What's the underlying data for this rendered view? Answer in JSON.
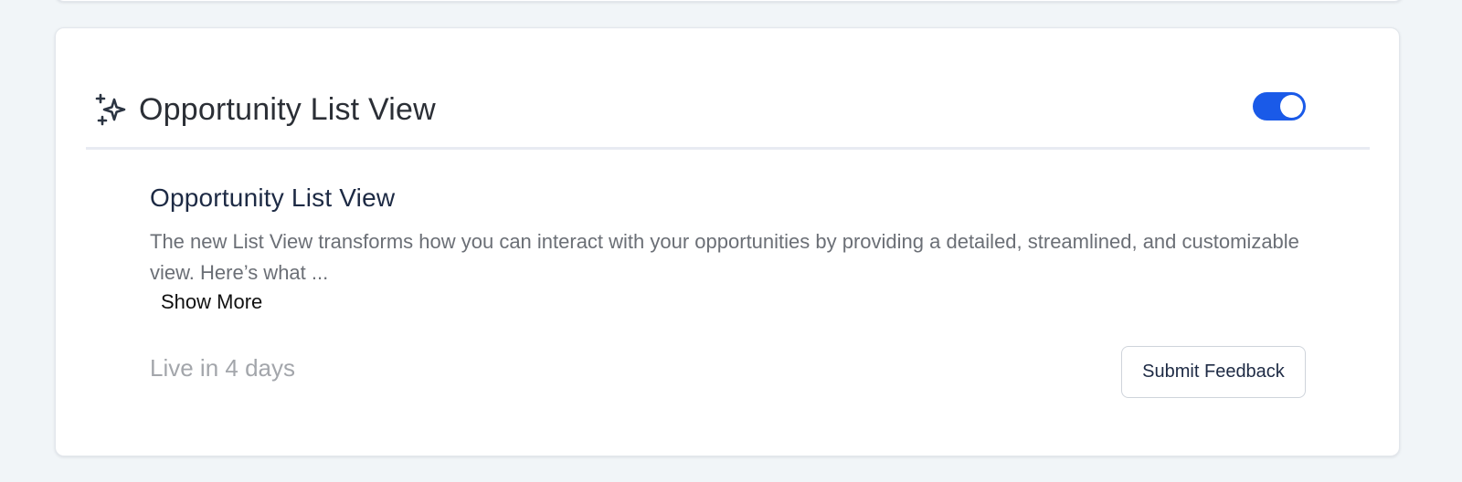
{
  "card": {
    "header_title": "Opportunity List View",
    "header_icon": "sparkle-icon",
    "toggle": {
      "state": "on",
      "color": "#1a5ae8"
    },
    "feature_title": "Opportunity List View",
    "description": "The new List View transforms how you can interact with your opportunities by providing a detailed, streamlined, and customizable view. Here’s what ...",
    "show_more_label": "Show More",
    "live_status": "Live in 4 days",
    "feedback_button_label": "Submit Feedback"
  }
}
